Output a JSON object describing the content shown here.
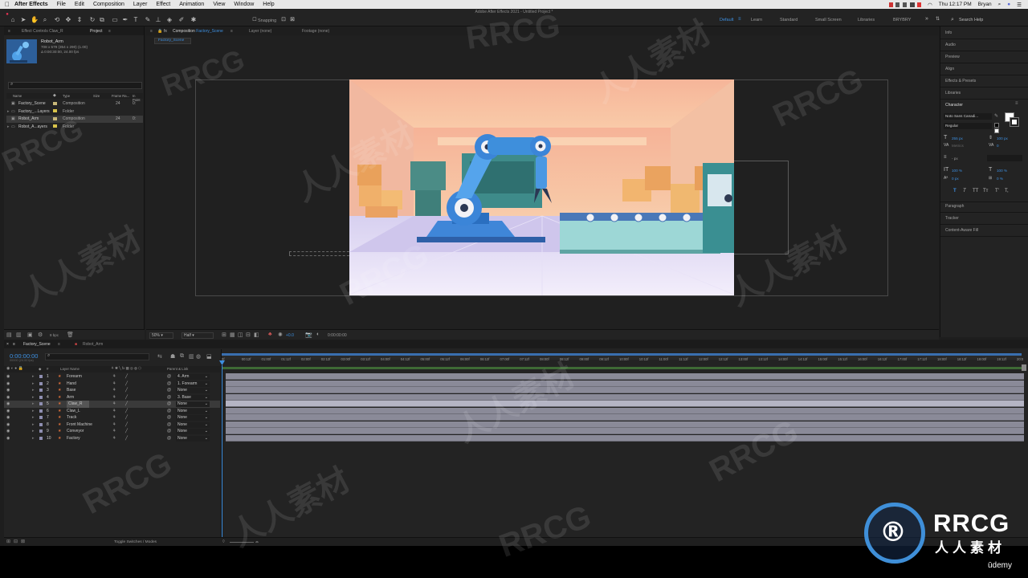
{
  "menubar": {
    "app_name": "After Effects",
    "items": [
      "File",
      "Edit",
      "Composition",
      "Layer",
      "Effect",
      "Animation",
      "View",
      "Window",
      "Help"
    ],
    "clock": "Thu 12:17 PM",
    "user": "Bryan"
  },
  "toolbar": {
    "window_title": "Adobe After Effects 2021 - Untitled Project *",
    "snapping_label": "Snapping",
    "workspaces": [
      "Default",
      "Learn",
      "Standard",
      "Small Screen",
      "Libraries",
      "BRYBRY"
    ],
    "active_workspace": "Default",
    "search_label": "Search Help"
  },
  "project_panel": {
    "tabs": [
      "Effect Controls Claw_R",
      "Project"
    ],
    "selected_item": {
      "name": "Robot_Arm",
      "line1": "708 x 579 (354 x 290) (1.00)",
      "line2": "Δ 0:00:30:00, 24.00 fps"
    },
    "search_placeholder": "",
    "columns": [
      "Name",
      "Type",
      "Size",
      "Frame Ra...",
      "In Point"
    ],
    "items": [
      {
        "name": "Factory_Scene",
        "type": "Composition",
        "fps": "24",
        "in": "0:",
        "color": "#c8b87a"
      },
      {
        "name": "Factory_...Layers",
        "type": "Folder",
        "fps": "",
        "in": "",
        "color": "#d8c34a"
      },
      {
        "name": "Robot_Arm",
        "type": "Composition",
        "fps": "24",
        "in": "0:",
        "color": "#c8b87a"
      },
      {
        "name": "Robot_A...ayers",
        "type": "Folder",
        "fps": "",
        "in": "",
        "color": "#d8c34a"
      }
    ],
    "bpc": "8 bpc"
  },
  "comp_panel": {
    "tabs": [
      "Composition Factory_Scene",
      "Layer (none)",
      "Footage (none)"
    ],
    "comp_button": "Factory_Scene",
    "zoom": "50%",
    "resolution": "Half",
    "exposure": "+0.0",
    "timecode": "0:00:00:00"
  },
  "right_panel": {
    "sections": [
      "Info",
      "Audio",
      "Preview",
      "Align",
      "Effects & Presets",
      "Libraries",
      "Character"
    ],
    "character": {
      "font": "Noto Sans Canadi...",
      "style": "Regular",
      "size": "255 px",
      "leading": "100 px",
      "kerning": "Metrics",
      "tracking": "0",
      "stroke": "- px",
      "vscale": "100 %",
      "hscale": "100 %",
      "baseline": "0 px",
      "tsume": "0 %",
      "styles": [
        "T",
        "T",
        "TT",
        "Tт",
        "T'",
        "T,"
      ]
    },
    "more_sections": [
      "Paragraph",
      "Tracker",
      "Content-Aware Fill"
    ]
  },
  "timeline": {
    "tabs": [
      "Factory_Scene",
      "Robot_Arm"
    ],
    "timecode": "0:00:00:00",
    "timecode_sub": "00000 (24.00 fps)",
    "columns": [
      "#",
      "Layer Name",
      "Parent & Link"
    ],
    "layers": [
      {
        "num": "1",
        "name": "Forearm",
        "parent": "4. Arm"
      },
      {
        "num": "2",
        "name": "Hand",
        "parent": "1. Forearm"
      },
      {
        "num": "3",
        "name": "Base",
        "parent": "None"
      },
      {
        "num": "4",
        "name": "Arm",
        "parent": "3. Base"
      },
      {
        "num": "5",
        "name": "Claw_R",
        "parent": "None"
      },
      {
        "num": "6",
        "name": "Claw_L",
        "parent": "None"
      },
      {
        "num": "7",
        "name": "Track",
        "parent": "None"
      },
      {
        "num": "8",
        "name": "Front Machine",
        "parent": "None"
      },
      {
        "num": "9",
        "name": "Conveyor",
        "parent": "None"
      },
      {
        "num": "10",
        "name": "Factory",
        "parent": "None"
      }
    ],
    "ruler": [
      "0f",
      "00:12f",
      "01:00f",
      "01:12f",
      "02:00f",
      "02:12f",
      "03:00f",
      "03:12f",
      "04:00f",
      "04:12f",
      "05:00f",
      "05:12f",
      "06:00f",
      "06:12f",
      "07:00f",
      "07:12f",
      "08:00f",
      "08:12f",
      "09:00f",
      "09:12f",
      "10:00f",
      "10:12f",
      "11:00f",
      "11:12f",
      "12:00f",
      "12:12f",
      "13:00f",
      "13:12f",
      "14:00f",
      "14:12f",
      "15:00f",
      "15:12f",
      "16:00f",
      "16:12f",
      "17:00f",
      "17:12f",
      "18:00f",
      "18:12f",
      "19:00f",
      "19:12f",
      "20:0"
    ],
    "toggle_label": "Toggle Switches / Modes"
  },
  "watermarks": {
    "brand": "RRCG",
    "brand_cn": "人人素材",
    "udemy": "ūdemy"
  }
}
